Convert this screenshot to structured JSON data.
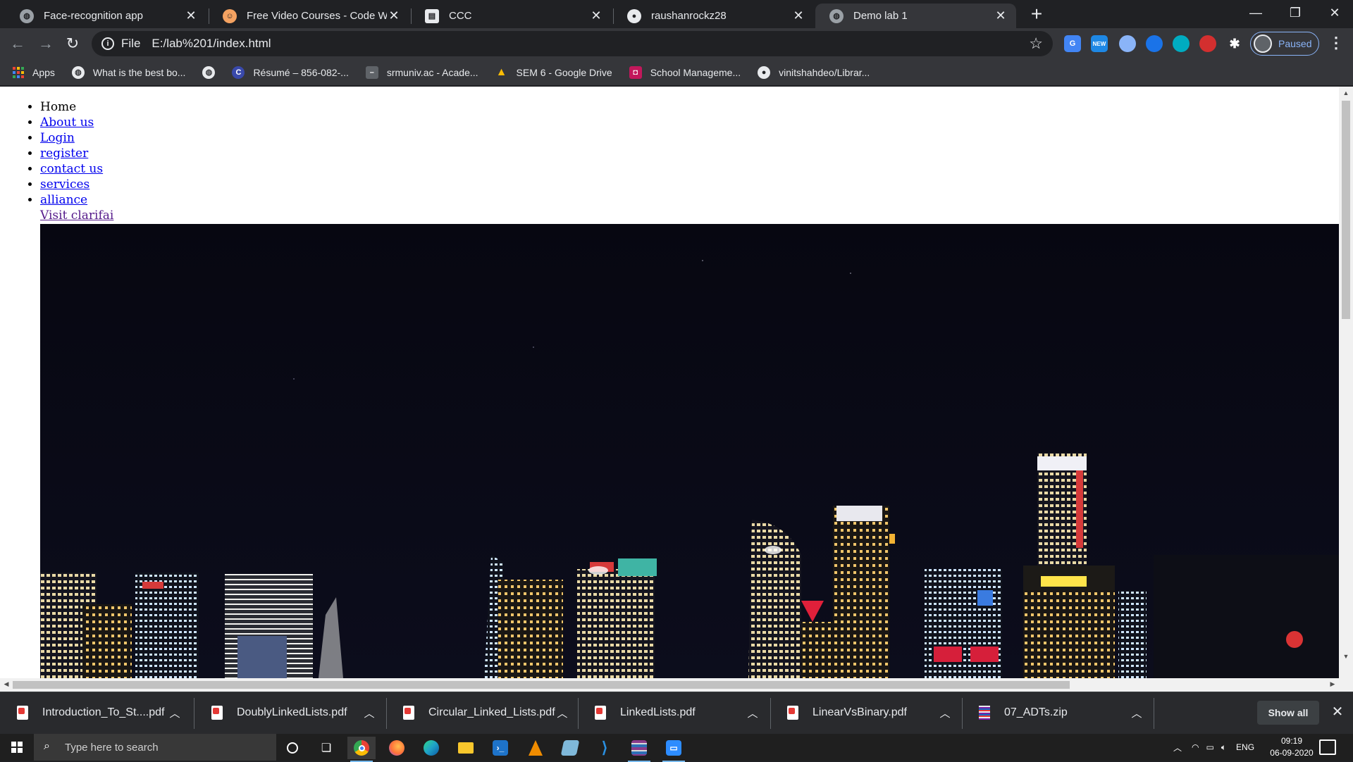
{
  "tabs": [
    {
      "title": "Face-recognition app",
      "favicon": "globe-icon",
      "color": "#9aa0a6"
    },
    {
      "title": "Free Video Courses - Code With",
      "favicon": "codewithharry-icon",
      "color": "#f4a261"
    },
    {
      "title": "CCC",
      "favicon": "document-icon",
      "color": "#e8eaed"
    },
    {
      "title": "raushanrockz28",
      "favicon": "github-icon",
      "color": "#e8eaed"
    },
    {
      "title": "Demo lab 1",
      "favicon": "globe-icon",
      "color": "#9aa0a6"
    }
  ],
  "address": {
    "scheme": "File",
    "url": "E:/lab%201/index.html"
  },
  "profile": {
    "label": "Paused"
  },
  "extensions": [
    {
      "name": "google-translate-icon",
      "color": "#4285f4",
      "text": "G"
    },
    {
      "name": "new-badge-extension-icon",
      "color": "#1e88e5",
      "text": "NEW"
    },
    {
      "name": "circle-extension-icon",
      "color": "#8ab4f8",
      "text": ""
    },
    {
      "name": "blue-circle-extension-icon",
      "color": "#1a73e8",
      "text": ""
    },
    {
      "name": "teal-circle-extension-icon",
      "color": "#00acc1",
      "text": ""
    },
    {
      "name": "red-extension-icon",
      "color": "#d32f2f",
      "text": ""
    },
    {
      "name": "puzzle-extensions-icon",
      "color": "#35363a",
      "text": "✱"
    }
  ],
  "bookmarks": [
    {
      "label": "Apps",
      "icon": "apps-grid-icon",
      "color": "#ffffff"
    },
    {
      "label": "What is the best bo...",
      "icon": "globe-icon",
      "color": "#e8eaed"
    },
    {
      "label": "",
      "icon": "globe-icon",
      "color": "#e8eaed"
    },
    {
      "label": "Résumé – 856-082-...",
      "icon": "c-icon",
      "color": "#3949ab"
    },
    {
      "label": "srmuniv.ac - Acade...",
      "icon": "dash-icon",
      "color": "#5f6368"
    },
    {
      "label": "SEM 6 - Google Drive",
      "icon": "google-drive-icon",
      "color": "#34a853"
    },
    {
      "label": "School Manageme...",
      "icon": "school-icon",
      "color": "#c2185b"
    },
    {
      "label": "vinitshahdeo/Librar...",
      "icon": "github-icon",
      "color": "#e8eaed"
    }
  ],
  "page": {
    "nav": {
      "home": "Home",
      "links": [
        "About us",
        "Login",
        "register",
        "contact us",
        "services",
        "alliance"
      ]
    },
    "visit_link": "Visit clarifai",
    "hero_image": "night-city-skyline-image"
  },
  "downloads": [
    {
      "name": "Introduction_To_St....pdf",
      "type": "pdf"
    },
    {
      "name": "DoublyLinkedLists.pdf",
      "type": "pdf"
    },
    {
      "name": "Circular_Linked_Lists.pdf",
      "type": "pdf"
    },
    {
      "name": "LinkedLists.pdf",
      "type": "pdf"
    },
    {
      "name": "LinearVsBinary.pdf",
      "type": "pdf"
    },
    {
      "name": "07_ADTs.zip",
      "type": "zip"
    }
  ],
  "download_shelf": {
    "show_all": "Show all"
  },
  "taskbar": {
    "search_placeholder": "Type here to search",
    "apps": [
      {
        "name": "cortana-icon",
        "color": "#1f1f1f"
      },
      {
        "name": "task-view-icon",
        "color": "#1f1f1f"
      },
      {
        "name": "chrome-icon",
        "color": "#4caf50"
      },
      {
        "name": "firefox-icon",
        "color": "#ff7139"
      },
      {
        "name": "edge-icon",
        "color": "#1fa3c8"
      },
      {
        "name": "file-explorer-icon",
        "color": "#f9c72c"
      },
      {
        "name": "powershell-icon",
        "color": "#1e73c9"
      },
      {
        "name": "vlc-icon",
        "color": "#f08c00"
      },
      {
        "name": "notepad-icon",
        "color": "#7fb8d9"
      },
      {
        "name": "vscode-icon",
        "color": "#2a8fe0"
      },
      {
        "name": "winrar-icon",
        "color": "#8a3b8a"
      },
      {
        "name": "zoom-icon",
        "color": "#2d8cff"
      }
    ],
    "tray": {
      "language": "ENG",
      "time": "09:19",
      "date": "06-09-2020"
    }
  }
}
